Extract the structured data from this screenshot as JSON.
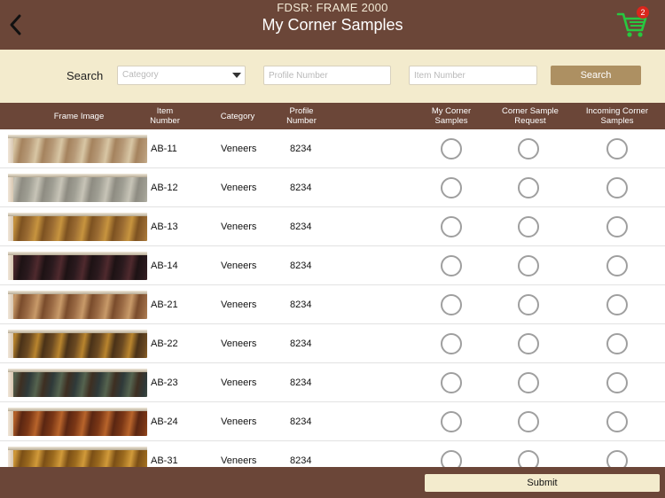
{
  "header": {
    "app_title": "FDSR: FRAME 2000",
    "page_title": "My Corner Samples",
    "back_icon": "chevron-left-icon",
    "cart_icon": "shopping-cart-icon",
    "cart_color": "#28c840",
    "cart_count": "2"
  },
  "search": {
    "label": "Search",
    "category_placeholder": "Category",
    "profile_placeholder": "Profile Number",
    "item_placeholder": "Item Number",
    "button_label": "Search"
  },
  "table": {
    "headers": {
      "image": "Frame Image",
      "item": "Item Number",
      "category": "Category",
      "profile": "Profile Number",
      "my_corner": "My Corner Samples",
      "request": "Corner Sample Request",
      "incoming": "Incoming Corner Samples"
    },
    "rows": [
      {
        "item": "AB-11",
        "category": "Veneers",
        "profile": "8234",
        "swatch": [
          "#b79a78",
          "#d8c6a4",
          "#a5835e"
        ]
      },
      {
        "item": "AB-12",
        "category": "Veneers",
        "profile": "8234",
        "swatch": [
          "#a09f94",
          "#c7c4b7",
          "#8e8c82"
        ]
      },
      {
        "item": "AB-13",
        "category": "Veneers",
        "profile": "8234",
        "swatch": [
          "#9b6c33",
          "#c7943f",
          "#7d5221"
        ]
      },
      {
        "item": "AB-14",
        "category": "Veneers",
        "profile": "8234",
        "swatch": [
          "#2b1a1e",
          "#4f2a2e",
          "#1d1214"
        ]
      },
      {
        "item": "AB-21",
        "category": "Veneers",
        "profile": "8234",
        "swatch": [
          "#9b6b45",
          "#c89a69",
          "#7a4c2c"
        ]
      },
      {
        "item": "AB-22",
        "category": "Veneers",
        "profile": "8234",
        "swatch": [
          "#6b4a22",
          "#b9852e",
          "#4a3218"
        ]
      },
      {
        "item": "AB-23",
        "category": "Veneers",
        "profile": "8234",
        "swatch": [
          "#2f3a3a",
          "#55634f",
          "#3e2f22"
        ]
      },
      {
        "item": "AB-24",
        "category": "Veneers",
        "profile": "8234",
        "swatch": [
          "#7b3716",
          "#b8642b",
          "#5a2612"
        ]
      },
      {
        "item": "AB-31",
        "category": "Veneers",
        "profile": "8234",
        "swatch": [
          "#9b6a1e",
          "#d19a3a",
          "#7b4f16"
        ]
      }
    ]
  },
  "footer": {
    "submit_label": "Submit"
  }
}
